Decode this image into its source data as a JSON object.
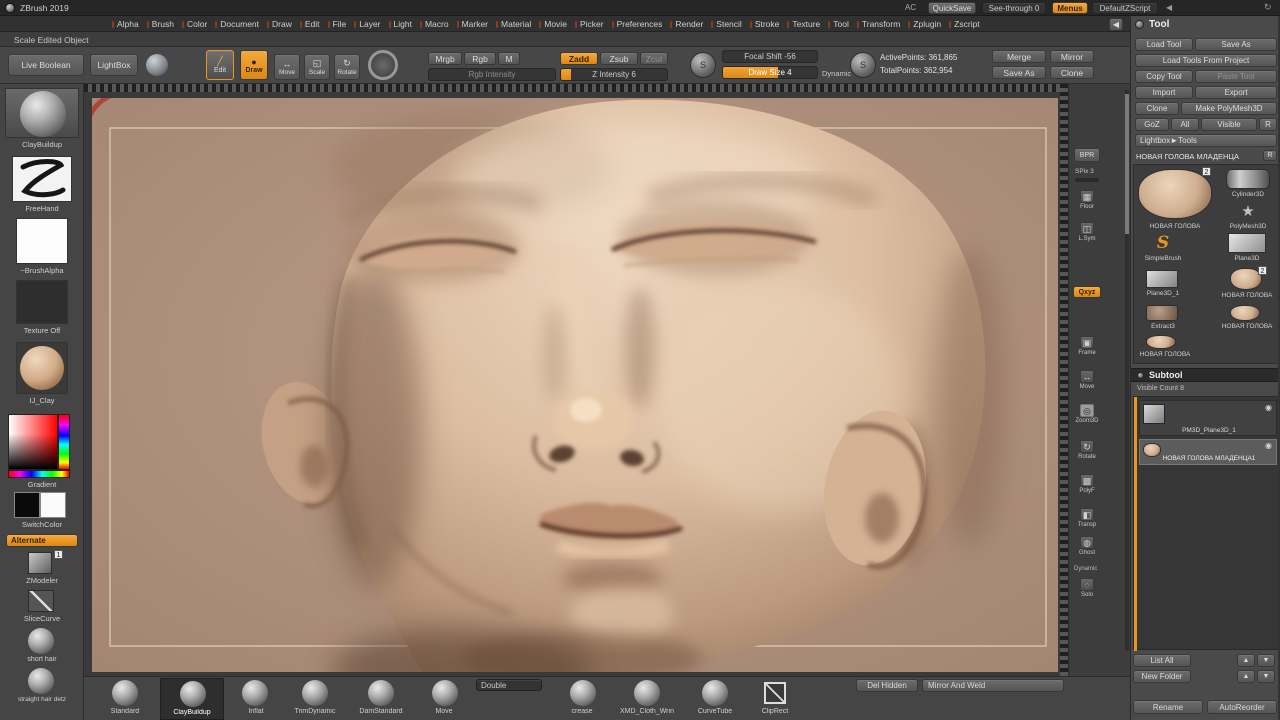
{
  "colors": {
    "accent": "#e8961e",
    "canvas_bg": "#b2937f"
  },
  "titlebar": {
    "title": "ZBrush 2019",
    "menus": [
      "Alpha",
      "Brush",
      "Color",
      "Document",
      "Draw",
      "Edit",
      "File",
      "Layer",
      "Light",
      "Macro",
      "Marker",
      "Material",
      "Movie",
      "Picker",
      "Preferences",
      "Render",
      "Stencil",
      "Stroke",
      "Texture",
      "Tool",
      "Transform",
      "Zplugin",
      "Zscript"
    ],
    "ac": "AC",
    "quicksave": "QuickSave",
    "see_through": "See-through 0",
    "menus_button": "Menus",
    "default_zscript": "DefaultZScript"
  },
  "hintbar": {
    "text": "Scale Edited Object"
  },
  "toolbar": {
    "live_boolean": "Live Boolean",
    "lightbox": "LightBox",
    "edit": "Edit",
    "draw": "Draw",
    "move": "Move",
    "scale": "Scale",
    "rotate": "Rotate",
    "mrgb": "Mrgb",
    "rgb": "Rgb",
    "m": "M",
    "zadd": "Zadd",
    "zsub": "Zsub",
    "zcut": "Zcut",
    "rgb_intensity": "Rgb Intensity",
    "z_intensity": "Z Intensity 6",
    "focal_shift": "Focal Shift -56",
    "draw_size": "Draw Size 4",
    "dynamic": "Dynamic",
    "active_points": "ActivePoints: 361,865",
    "total_points": "TotalPoints: 362,954",
    "merge": "Merge",
    "mirror": "Mirror",
    "save_as": "Save As",
    "clone": "Clone"
  },
  "left_shelf": {
    "brush_label": "ClayBuildup",
    "stroke_label": "FreeHand",
    "alpha_label": "~BrushAlpha",
    "texture_label": "Texture Off",
    "material_label": "IJ_Clay",
    "gradient_label": "Gradient",
    "switch_color_label": "SwitchColor",
    "alternate_label": "Alternate",
    "zmodeler_label": "ZModeler",
    "zmodeler_badge": "1",
    "slicecurve_label": "SliceCurve",
    "short_hair_label": "short hair",
    "straight_hair_label": "straight hair detz"
  },
  "right_strip": {
    "bpr": "BPR",
    "spix": "SPix 3",
    "floor": "Floor",
    "lsym": "L.Sym",
    "qxyz": "Qxyz",
    "frame": "Frame",
    "move": "Move",
    "zoom3d": "Zoom3D",
    "rotate": "Rotate",
    "polyf": "PolyF",
    "transp": "Transp",
    "ghost": "Ghost",
    "dynamic": "Dynamic",
    "solo": "Solo"
  },
  "tool_panel": {
    "title": "Tool",
    "load_tool": "Load Tool",
    "save_as": "Save As",
    "load_from_project": "Load Tools From Project",
    "copy_tool": "Copy Tool",
    "paste_tool": "Paste Tool",
    "import": "Import",
    "export": "Export",
    "clone": "Clone",
    "make_polymesh": "Make PolyMesh3D",
    "goz": "GoZ",
    "all": "All",
    "visible": "Visible",
    "r": "R",
    "lightbox_tools": "Lightbox►Tools",
    "current_tool": "НОВАЯ ГОЛОВА МЛАДЕНЦА",
    "thumbs": {
      "selected": {
        "label": "НОВАЯ ГОЛОВА",
        "badge": "2"
      },
      "cylinder": {
        "label": "Cylinder3D"
      },
      "polymesh": {
        "label": "PolyMesh3D"
      },
      "simplebrush": {
        "label": "SimpleBrush"
      },
      "plane": {
        "label": "Plane3D"
      },
      "plane1": {
        "label": "Plane3D_1"
      },
      "head2": {
        "label": "НОВАЯ ГОЛОВА",
        "badge": "2"
      },
      "extract": {
        "label": "Extract3"
      },
      "head3": {
        "label": "НОВАЯ ГОЛОВА"
      },
      "head4": {
        "label": "НОВАЯ ГОЛОВА"
      }
    }
  },
  "subtool_panel": {
    "title": "Subtool",
    "visible_count": "Visible Count 8",
    "item1": "PM3D_Plane3D_1",
    "item2": "НОВАЯ ГОЛОВА МЛАДЕНЦА1",
    "list_all": "List All",
    "new_folder": "New Folder",
    "rename": "Rename",
    "auto_reorder": "AutoReorder"
  },
  "bottom_bar": {
    "brushes": [
      "Standard",
      "ClayBuildup",
      "Inflat",
      "TrimDynamic",
      "DamStandard",
      "Move",
      "crease",
      "XMD_Cloth_Wrin",
      "CurveTube",
      "ClipRect"
    ],
    "double": "Double",
    "del_hidden": "Del Hidden",
    "mirror_and_weld": "Mirror And Weld"
  }
}
